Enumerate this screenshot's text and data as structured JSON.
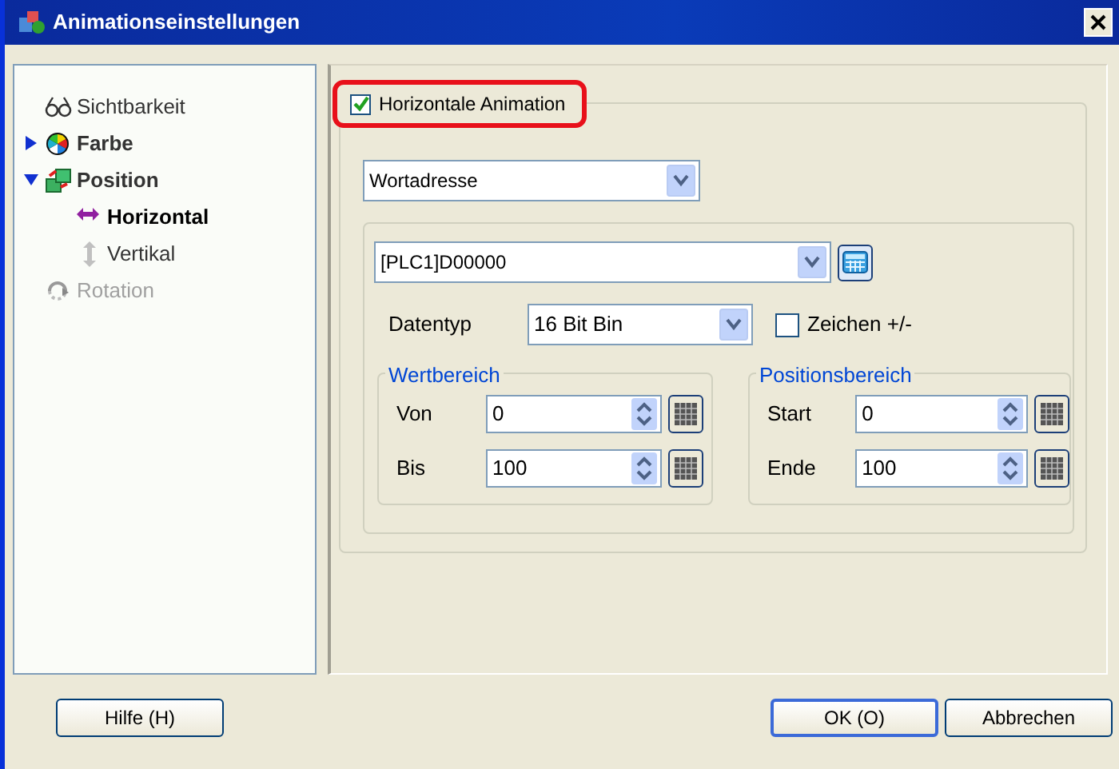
{
  "window": {
    "title": "Animationseinstellungen"
  },
  "tree": [
    {
      "label": "Sichtbarkeit",
      "selected": false,
      "disabled": false
    },
    {
      "label": "Farbe",
      "expanded": false,
      "selected": false,
      "disabled": false
    },
    {
      "label": "Position",
      "expanded": true,
      "selected": false,
      "disabled": false,
      "children": [
        {
          "label": "Horizontal",
          "selected": true,
          "disabled": false
        },
        {
          "label": "Vertikal",
          "selected": false,
          "disabled": false
        }
      ]
    },
    {
      "label": "Rotation",
      "selected": false,
      "disabled": true
    }
  ],
  "animation_checkbox": {
    "label": "Horizontale Animation",
    "checked": true,
    "highlighted": true
  },
  "source_select": {
    "value": "Wortadresse"
  },
  "address": {
    "value": "[PLC1]D00000"
  },
  "data_type": {
    "label": "Datentyp",
    "value": "16 Bit Bin"
  },
  "sign_checkbox": {
    "label": "Zeichen +/-",
    "checked": false
  },
  "ranges": [
    {
      "title": "Wertbereich",
      "fields": [
        {
          "label": "Von",
          "value": "0"
        },
        {
          "label": "Bis",
          "value": "100"
        }
      ]
    },
    {
      "title": "Positionsbereich",
      "fields": [
        {
          "label": "Start",
          "value": "0"
        },
        {
          "label": "Ende",
          "value": "100"
        }
      ]
    }
  ],
  "buttons": [
    {
      "label": "Hilfe (H)",
      "default": false
    },
    {
      "label": "OK (O)",
      "default": true
    },
    {
      "label": "Abbrechen",
      "default": false
    }
  ]
}
